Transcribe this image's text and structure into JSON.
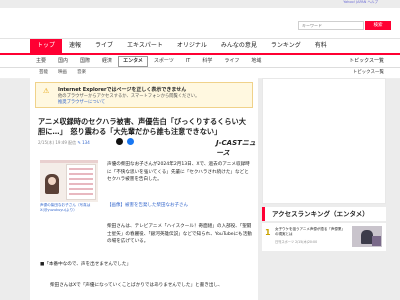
{
  "top": {
    "right_link": "Yahoo! JAPAN ヘルプ"
  },
  "search": {
    "placeholder": "キーワード",
    "button": "検索"
  },
  "nav1": [
    "トップ",
    "速報",
    "ライブ",
    "エキスパート",
    "オリジナル",
    "みんなの意見",
    "ランキング",
    "有料"
  ],
  "nav2": {
    "items": [
      "主要",
      "国内",
      "国際",
      "経済",
      "エンタメ",
      "スポーツ",
      "IT",
      "科学",
      "ライフ",
      "地域"
    ],
    "topics": "トピックス一覧"
  },
  "nav3": {
    "items": [
      "芸能",
      "映画",
      "音楽"
    ],
    "trends": "トピックス一覧"
  },
  "ie_notice": {
    "title": "Internet Explorerではページを正しく表示できません",
    "line2": "他のブラウザーからアクセスするか、スマートフォンから閲覧ください。",
    "link": "推奨ブラウザーについて"
  },
  "article": {
    "headline": "アニメ収録時のセクハラ被害、声優告白「びっくりするくらい大胆に…」　怒り震わる「大先輩だから誰も注意できない」",
    "meta": "2/15(木) 19:49 配信",
    "comments": "134",
    "publisher": "J-CASTニュース",
    "photo_caption": "声優の柴田なお子さん（写真はX(@yuzukuyu)より）",
    "para1": "声優の柴田なお子さんが2024年2月13日、Xで、過去のアニメ収録時に「不快な思いを強いてくる」先輩に「セクハラされ続けた」などとセクハラ被害を告白した。",
    "related": "【画像】被害を告発した柴田なお子さん",
    "para2": "柴田さんは、テレビアニメ「ハイスクール！奇面組」の入部役、「聖闘士星矢」の春麗役、「銀河英雄伝説」などで知られ、YouTubeにも活動の場を広げている。",
    "quote": "■「本番中なので、声を出せませんでした」",
    "para3": "柴田さんはXで「声優になっていくことばかりではありませんでした」と書き出し、"
  },
  "ranking": {
    "title": "アクセスランキング（エンタメ）",
    "item1": {
      "rank": "1",
      "text": "女子ウケを狙うアニメ声優が語る「声優業」の現実とは",
      "source": "日刊スポーツ 2/15(木)20:00"
    }
  }
}
